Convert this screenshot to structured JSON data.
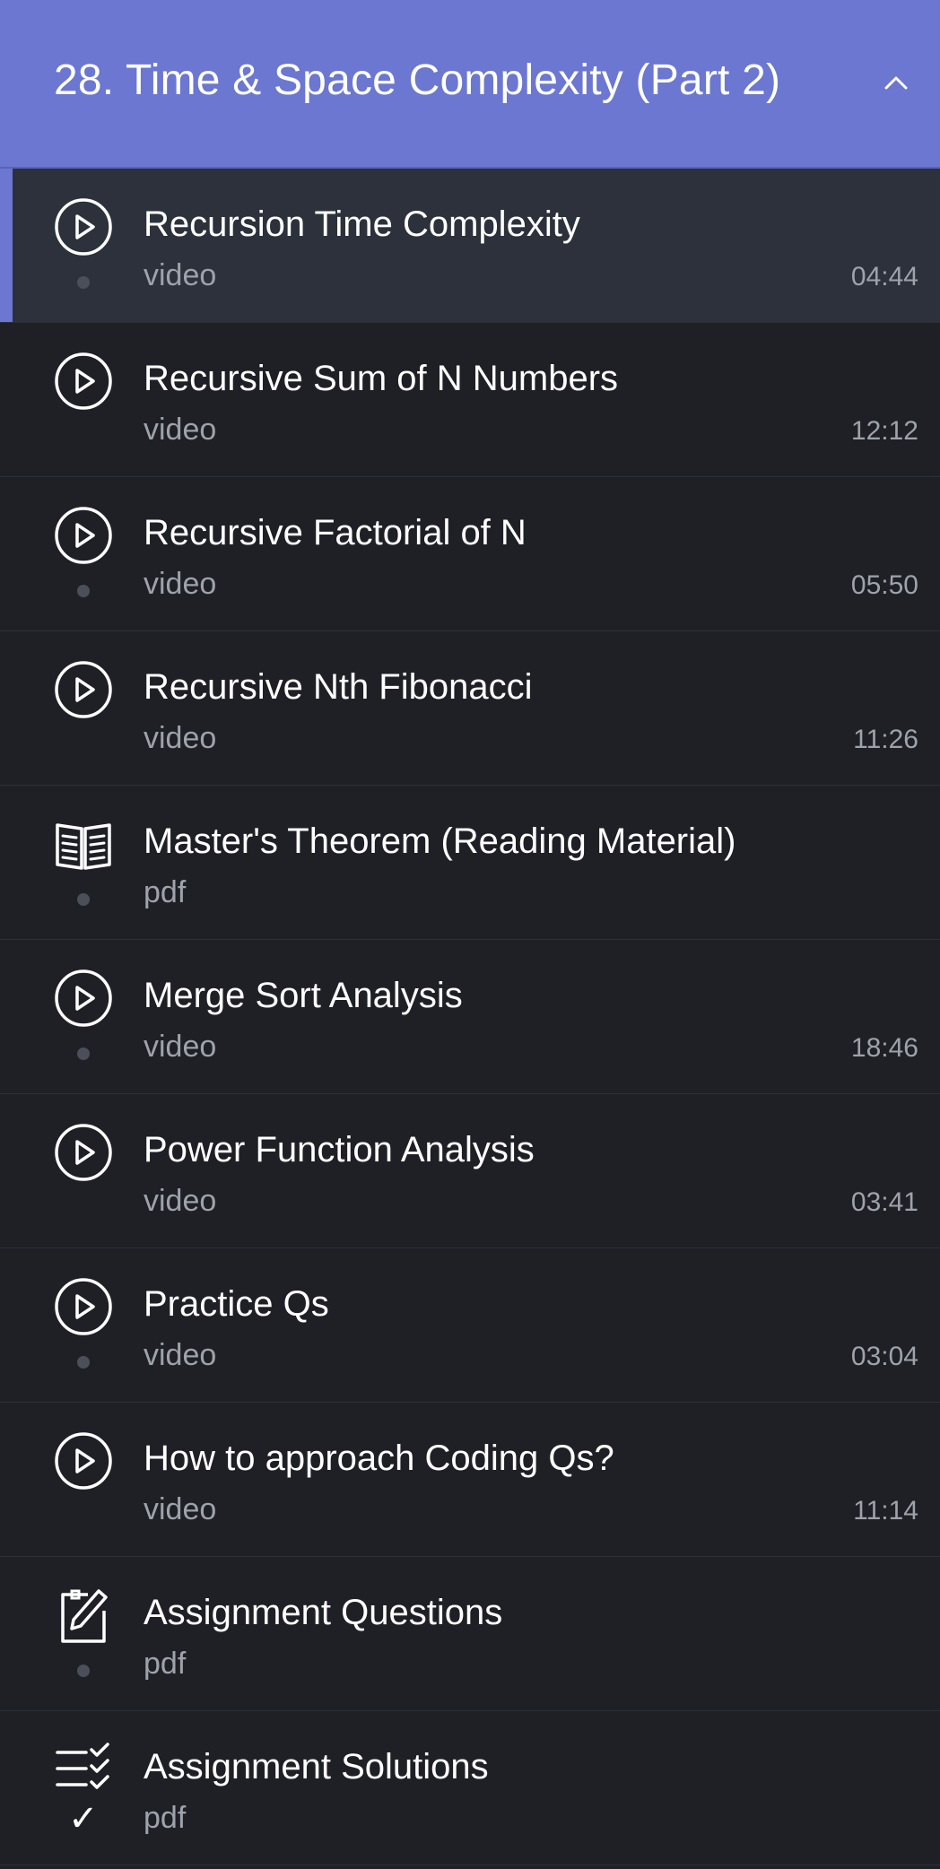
{
  "header": {
    "title": "28. Time & Space Complexity (Part 2)",
    "toggle_icon": "chevron-up-icon"
  },
  "colors": {
    "header_bg": "#6b77d0",
    "list_bg": "#1f2026",
    "active_bg": "#2c313b",
    "muted_text": "#9ea2ab"
  },
  "items": [
    {
      "title": "Recursion Time Complexity",
      "type": "video",
      "duration": "04:44",
      "icon": "play-circle-icon",
      "status": "dot",
      "active": true
    },
    {
      "title": "Recursive Sum of N Numbers",
      "type": "video",
      "duration": "12:12",
      "icon": "play-circle-icon",
      "status": "none",
      "active": false
    },
    {
      "title": "Recursive Factorial of N",
      "type": "video",
      "duration": "05:50",
      "icon": "play-circle-icon",
      "status": "dot",
      "active": false
    },
    {
      "title": "Recursive Nth Fibonacci",
      "type": "video",
      "duration": "11:26",
      "icon": "play-circle-icon",
      "status": "none",
      "active": false
    },
    {
      "title": "Master's Theorem (Reading Material)",
      "type": "pdf",
      "duration": "",
      "icon": "open-book-icon",
      "status": "dot",
      "active": false
    },
    {
      "title": "Merge Sort Analysis",
      "type": "video",
      "duration": "18:46",
      "icon": "play-circle-icon",
      "status": "dot",
      "active": false
    },
    {
      "title": "Power Function Analysis",
      "type": "video",
      "duration": "03:41",
      "icon": "play-circle-icon",
      "status": "none",
      "active": false
    },
    {
      "title": "Practice Qs",
      "type": "video",
      "duration": "03:04",
      "icon": "play-circle-icon",
      "status": "dot",
      "active": false
    },
    {
      "title": "How to approach Coding Qs?",
      "type": "video",
      "duration": "11:14",
      "icon": "play-circle-icon",
      "status": "none",
      "active": false
    },
    {
      "title": "Assignment Questions",
      "type": "pdf",
      "duration": "",
      "icon": "edit-note-icon",
      "status": "dot",
      "active": false
    },
    {
      "title": "Assignment Solutions",
      "type": "pdf",
      "duration": "",
      "icon": "checklist-icon",
      "status": "check",
      "active": false
    }
  ]
}
